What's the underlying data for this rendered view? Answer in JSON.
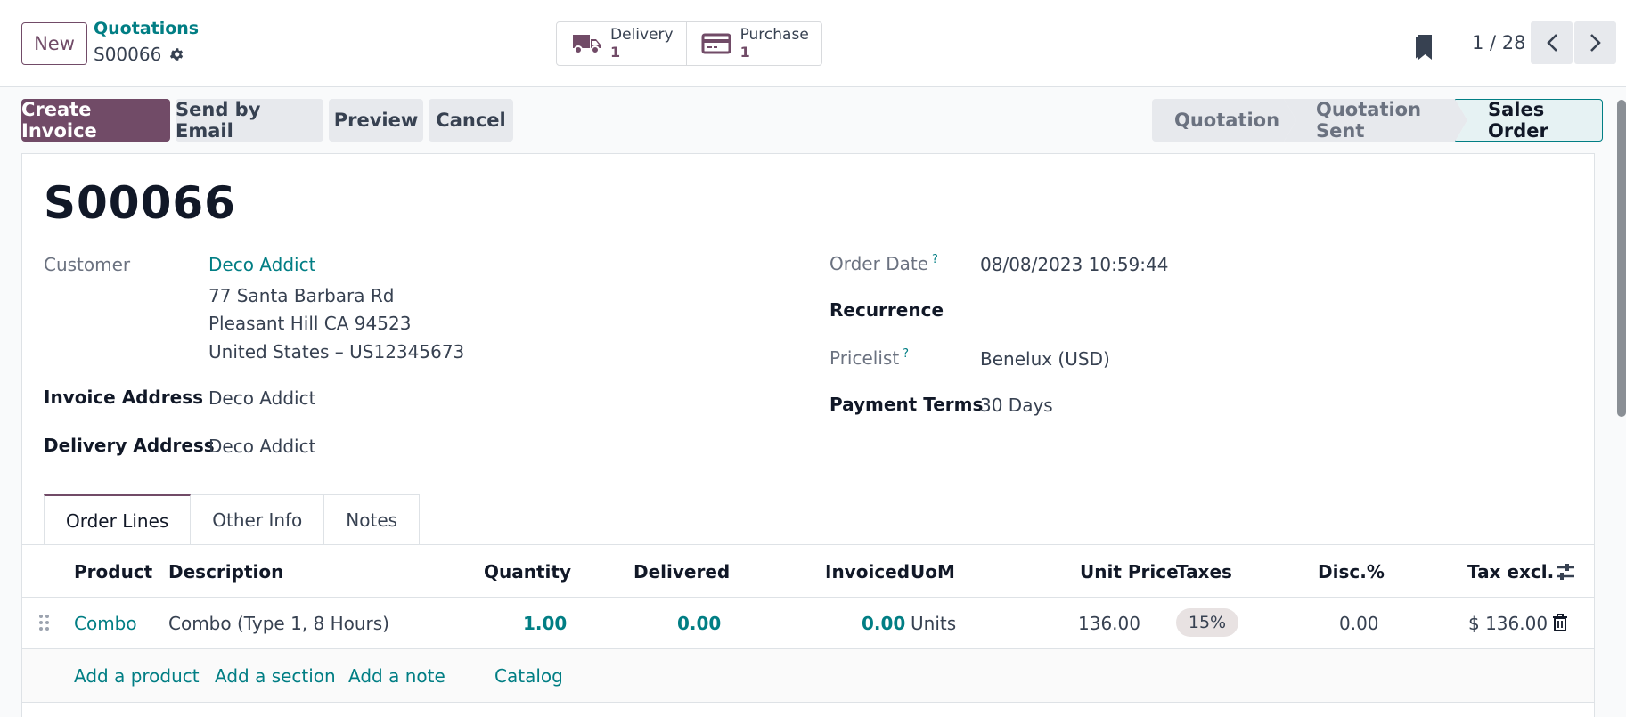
{
  "control_panel": {
    "new_label": "New",
    "breadcrumb_parent": "Quotations",
    "breadcrumb_current": "S00066",
    "smart_buttons": [
      {
        "label": "Delivery",
        "count": "1",
        "icon": "truck-icon"
      },
      {
        "label": "Purchase",
        "count": "1",
        "icon": "credit-card-icon"
      }
    ],
    "pager": "1 / 28"
  },
  "actions": {
    "create_invoice": "Create Invoice",
    "send_email": "Send by Email",
    "preview": "Preview",
    "cancel": "Cancel"
  },
  "status_stages": [
    {
      "label": "Quotation",
      "active": false
    },
    {
      "label": "Quotation Sent",
      "active": false
    },
    {
      "label": "Sales Order",
      "active": true
    }
  ],
  "record": {
    "name": "S00066",
    "customer_label": "Customer",
    "customer_name": "Deco Addict",
    "address_line1": "77 Santa Barbara Rd",
    "address_line2": "Pleasant Hill CA 94523",
    "address_line3": "United States – US12345673",
    "invoice_address_label": "Invoice Address",
    "invoice_address": "Deco Addict",
    "delivery_address_label": "Delivery Address",
    "delivery_address": "Deco Addict",
    "order_date_label": "Order Date",
    "order_date": "08/08/2023 10:59:44",
    "recurrence_label": "Recurrence",
    "pricelist_label": "Pricelist",
    "pricelist": "Benelux (USD)",
    "payment_terms_label": "Payment Terms",
    "payment_terms": "30 Days",
    "help_mark": "?"
  },
  "tabs": [
    "Order Lines",
    "Other Info",
    "Notes"
  ],
  "order_lines": {
    "columns": [
      "Product",
      "Description",
      "Quantity",
      "Delivered",
      "Invoiced",
      "UoM",
      "Unit Price",
      "Taxes",
      "Disc.%",
      "Tax excl."
    ],
    "rows": [
      {
        "product": "Combo",
        "description": "Combo (Type 1, 8 Hours)",
        "quantity": "1.00",
        "delivered": "0.00",
        "invoiced": "0.00",
        "uom": "Units",
        "unit_price": "136.00",
        "taxes": "15%",
        "discount": "0.00",
        "subtotal": "$ 136.00"
      }
    ],
    "add_product": "Add a product",
    "add_section": "Add a section",
    "add_note": "Add a note",
    "catalog": "Catalog"
  },
  "colors": {
    "primary": "#714b67",
    "link": "#017e84"
  }
}
